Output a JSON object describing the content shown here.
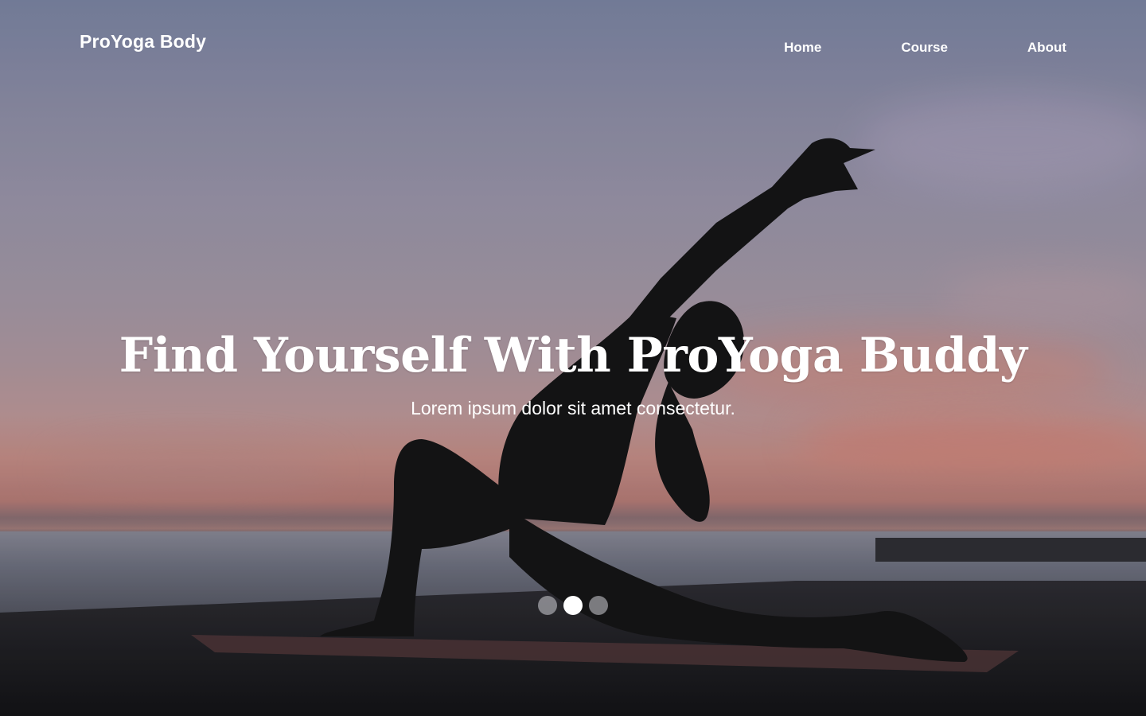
{
  "brand": {
    "name": "ProYoga Body"
  },
  "nav": {
    "items": [
      {
        "label": "Home"
      },
      {
        "label": "Course"
      },
      {
        "label": "About"
      }
    ]
  },
  "hero": {
    "title": "Find Yourself With ProYoga Buddy",
    "subtitle": "Lorem ipsum dolor sit amet consectetur.",
    "background": "sunset-yoga-silhouette-photo"
  },
  "carousel": {
    "slide_count": 3,
    "active_index": 1
  },
  "colors": {
    "text": "#ffffff",
    "dot_inactive": "#a8a8ae",
    "dot_active": "#ffffff"
  }
}
